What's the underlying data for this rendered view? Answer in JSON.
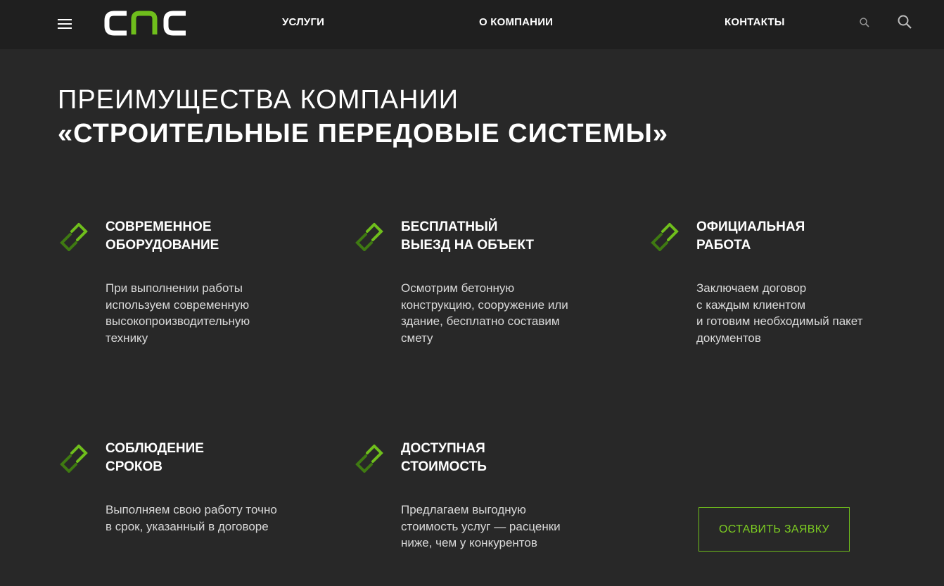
{
  "header": {
    "logo_text": "СПС",
    "nav": {
      "services": "УСЛУГИ",
      "about": "О КОМПАНИИ",
      "contacts": "КОНТАКТЫ"
    },
    "icons": [
      "menu-icon",
      "search-icon",
      "search-icon"
    ]
  },
  "main": {
    "title_line1": "ПРЕИМУЩЕСТВА КОМПАНИИ",
    "title_line2": "«СТРОИТЕЛЬНЫЕ ПЕРЕДОВЫЕ СИСТЕМЫ»",
    "features": [
      {
        "heading": "СОВРЕМЕННОЕ\nОБОРУДОВАНИЕ",
        "text": "При выполнении работы\nиспользуем современную\nвысокопроизводительную\nтехнику",
        "icon": "link-icon"
      },
      {
        "heading": "БЕСПЛАТНЫЙ\nВЫЕЗД НА ОБЪЕКТ",
        "text": "Осмотрим бетонную\nконструкцию, сооружение или\nздание, бесплатно составим\nсмету",
        "icon": "link-icon"
      },
      {
        "heading": "ОФИЦИАЛЬНАЯ\nРАБОТА",
        "text": "Заключаем договор\nс каждым клиентом\nи готовим необходимый пакет\nдокументов",
        "icon": "link-icon"
      },
      {
        "heading": "СОБЛЮДЕНИЕ\nСРОКОВ",
        "text": "Выполняем свою работу точно\nв срок, указанный в договоре",
        "icon": "link-icon"
      },
      {
        "heading": "ДОСТУПНАЯ\nСТОИМОСТЬ",
        "text": "Предлагаем выгодную\nстоимость услуг — расценки\nниже, чем у конкурентов",
        "icon": "link-icon"
      }
    ],
    "cta_label": "ОСТАВИТЬ ЗАЯВКУ"
  },
  "colors": {
    "background": "#282828",
    "header": "#1f1f1f",
    "accent": "#6fbe1c",
    "accent_dark": "#3f7a12"
  }
}
